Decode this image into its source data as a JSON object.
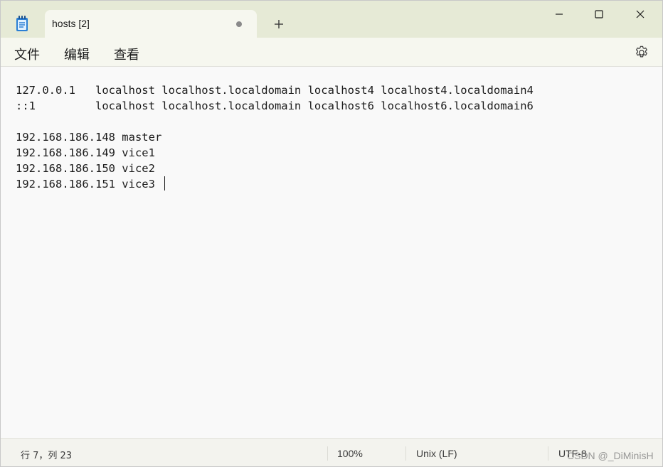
{
  "window": {
    "tab_title": "hosts [2]",
    "tab_modified": true
  },
  "menu": {
    "file": "文件",
    "edit": "编辑",
    "view": "查看"
  },
  "editor": {
    "lines": [
      "127.0.0.1   localhost localhost.localdomain localhost4 localhost4.localdomain4",
      "::1         localhost localhost.localdomain localhost6 localhost6.localdomain6",
      "",
      "192.168.186.148 master",
      "192.168.186.149 vice1",
      "192.168.186.150 vice2",
      "192.168.186.151 vice3 "
    ]
  },
  "status": {
    "position": "行 7，列 23",
    "zoom": "100%",
    "line_ending": "Unix (LF)",
    "encoding": "UTF-8"
  },
  "watermark": "CSDN @_DiMinisH",
  "icons": {
    "app": "notepad-icon",
    "new_tab": "plus-icon",
    "minimize": "minimize-icon",
    "maximize": "maximize-icon",
    "close": "close-icon",
    "settings": "gear-icon"
  },
  "colors": {
    "titlebar": "#e6ead6",
    "tab": "#f6f7ef",
    "editor_bg": "#f9f9f9",
    "statusbar": "#f3f3ee"
  }
}
